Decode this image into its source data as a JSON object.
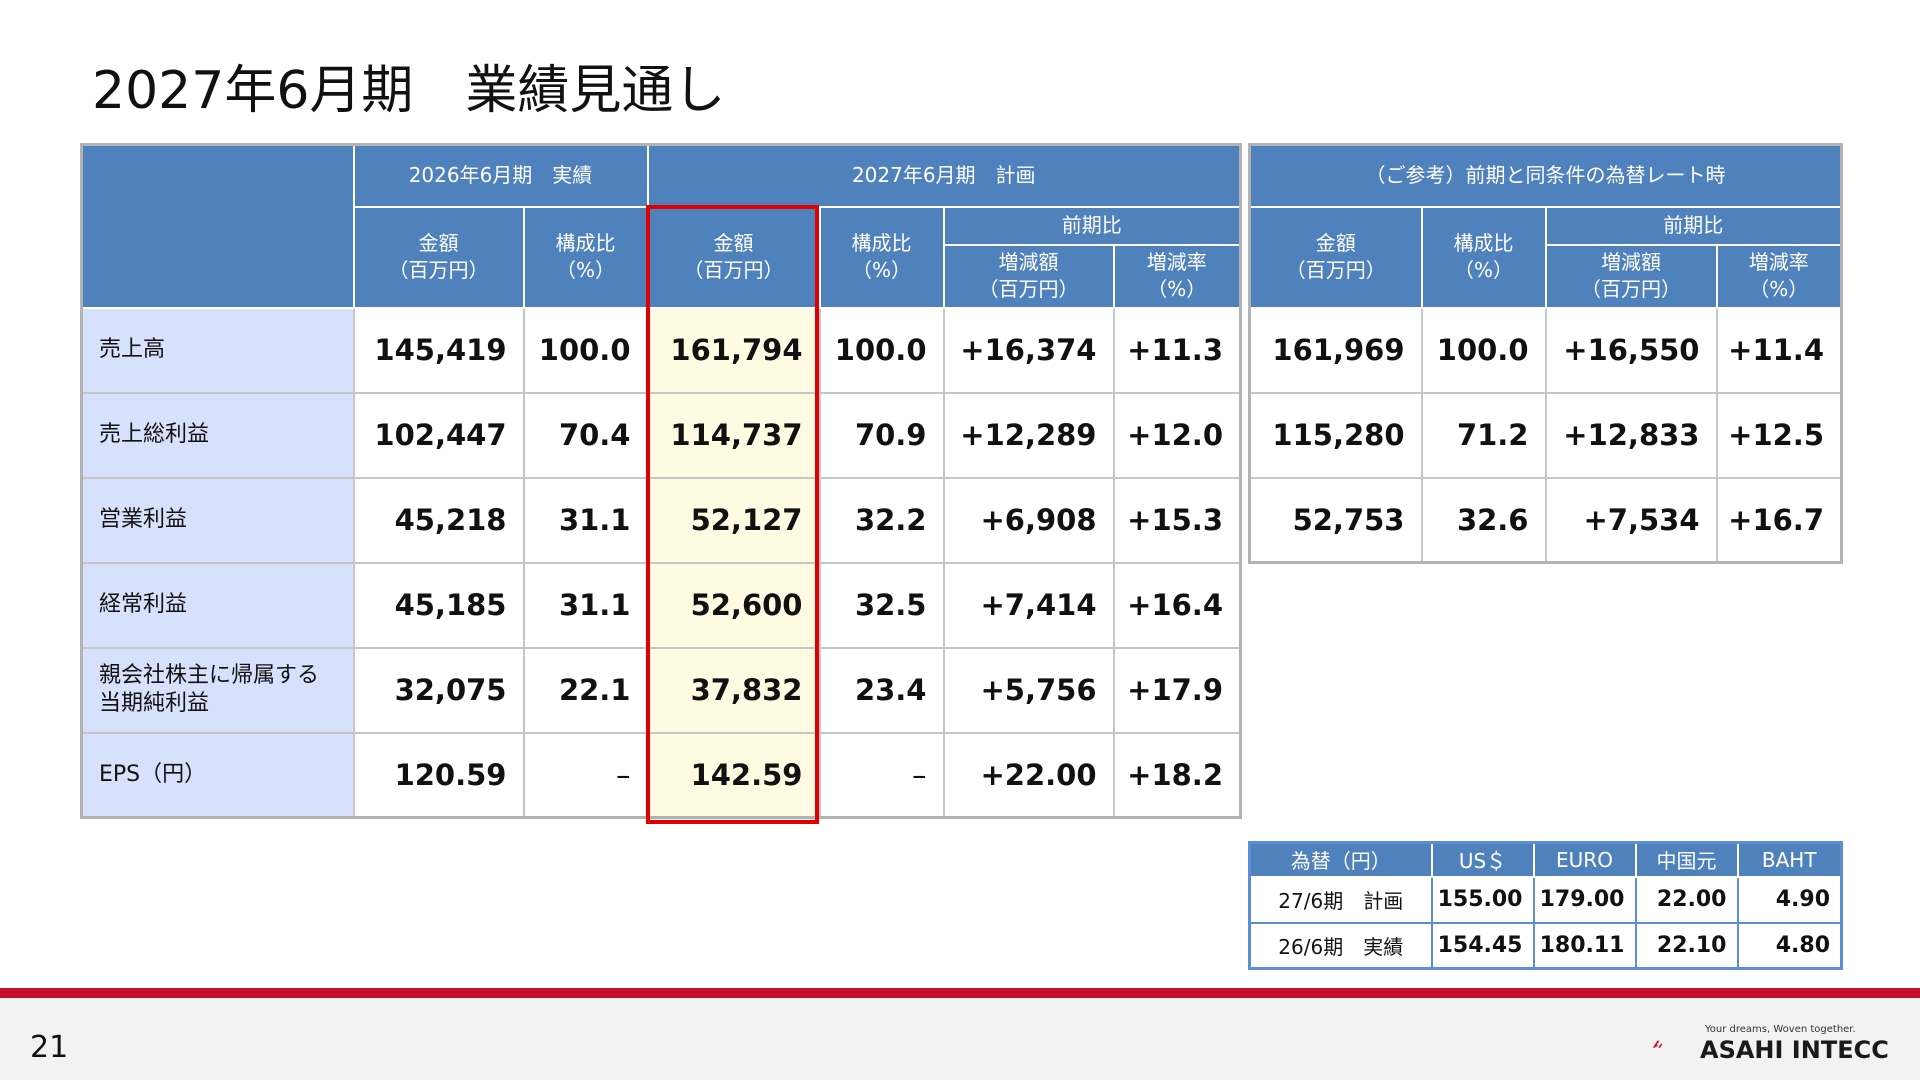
{
  "title": "2027年6月期　業績見通し",
  "main_table": {
    "group_headers": {
      "actual": "2026年6月期　実績",
      "plan": "2027年6月期　計画",
      "reference": "（ご参考）前期と同条件の為替レート時"
    },
    "col_headers": {
      "amount_1": "金額",
      "amount_2": "（百万円）",
      "ratio_1": "構成比",
      "ratio_2": "（%）",
      "yoy": "前期比",
      "diff_1": "増減額",
      "diff_2": "（百万円）",
      "rate_1": "増減率",
      "rate_2": "（%）"
    },
    "rows": [
      {
        "label": "売上高",
        "label2": "",
        "a_amt": "145,419",
        "a_ratio": "100.0",
        "p_amt": "161,794",
        "p_ratio": "100.0",
        "p_diff": "+16,374",
        "p_rate": "+11.3",
        "r_amt": "161,969",
        "r_ratio": "100.0",
        "r_diff": "+16,550",
        "r_rate": "+11.4"
      },
      {
        "label": "売上総利益",
        "label2": "",
        "a_amt": "102,447",
        "a_ratio": "70.4",
        "p_amt": "114,737",
        "p_ratio": "70.9",
        "p_diff": "+12,289",
        "p_rate": "+12.0",
        "r_amt": "115,280",
        "r_ratio": "71.2",
        "r_diff": "+12,833",
        "r_rate": "+12.5"
      },
      {
        "label": "営業利益",
        "label2": "",
        "a_amt": "45,218",
        "a_ratio": "31.1",
        "p_amt": "52,127",
        "p_ratio": "32.2",
        "p_diff": "+6,908",
        "p_rate": "+15.3",
        "r_amt": "52,753",
        "r_ratio": "32.6",
        "r_diff": "+7,534",
        "r_rate": "+16.7"
      },
      {
        "label": "経常利益",
        "label2": "",
        "a_amt": "45,185",
        "a_ratio": "31.1",
        "p_amt": "52,600",
        "p_ratio": "32.5",
        "p_diff": "+7,414",
        "p_rate": "+16.4"
      },
      {
        "label": "親会社株主に帰属する",
        "label2": "当期純利益",
        "a_amt": "32,075",
        "a_ratio": "22.1",
        "p_amt": "37,832",
        "p_ratio": "23.4",
        "p_diff": "+5,756",
        "p_rate": "+17.9"
      },
      {
        "label": "EPS（円）",
        "label2": "",
        "a_amt": "120.59",
        "a_ratio": "–",
        "p_amt": "142.59",
        "p_ratio": "–",
        "p_diff": "+22.00",
        "p_rate": "+18.2"
      }
    ]
  },
  "fx_table": {
    "headers": [
      "為替（円）",
      "US＄",
      "EURO",
      "中国元",
      "BAHT"
    ],
    "rows": [
      {
        "label": "27/6期　計画",
        "values": [
          "155.00",
          "179.00",
          "22.00",
          "4.90"
        ]
      },
      {
        "label": "26/6期　実績",
        "values": [
          "154.45",
          "180.11",
          "22.10",
          "4.80"
        ]
      }
    ]
  },
  "footer": {
    "page_number": "21",
    "tagline": "Your dreams, Woven together.",
    "company": "ASAHI INTECC"
  },
  "colors": {
    "header_blue": "#4f81bd",
    "label_bg": "#d7e1fb",
    "highlight_bg": "#fffbe2",
    "highlight_border": "#e00000",
    "footer_red": "#c8102e"
  }
}
